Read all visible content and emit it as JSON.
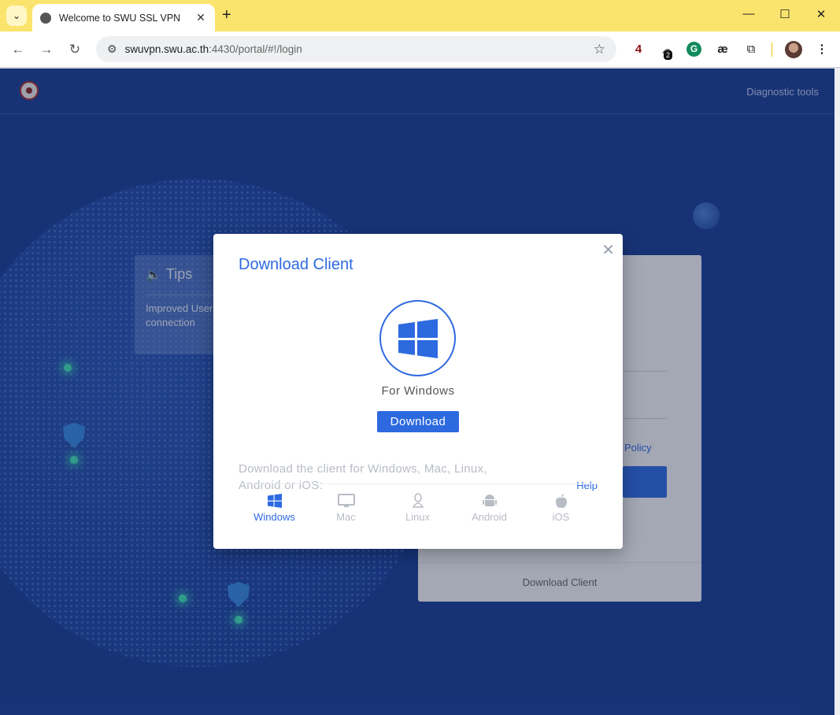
{
  "browser": {
    "tab_title": "Welcome to SWU SSL VPN",
    "url_host": "swuvpn.swu.ac.th",
    "url_rest": ":4430/portal/#!/login",
    "ext_badge": "2",
    "ext_ae": "æ",
    "ext_4": "4"
  },
  "header": {
    "diagnostic_tools": "Diagnostic tools"
  },
  "tips": {
    "title": "Tips",
    "text": "Improved User connection"
  },
  "login": {
    "policy_link": "Policy",
    "download_client": "Download Client"
  },
  "modal": {
    "title": "Download Client",
    "os_label": "For Windows",
    "download_button": "Download",
    "description": "Download the client for Windows, Mac, Linux, Android or iOS:",
    "help_link": "Help",
    "os_tabs": [
      {
        "label": "Windows",
        "icon": "windows-icon",
        "active": true
      },
      {
        "label": "Mac",
        "icon": "mac-icon",
        "active": false
      },
      {
        "label": "Linux",
        "icon": "linux-icon",
        "active": false
      },
      {
        "label": "Android",
        "icon": "android-icon",
        "active": false
      },
      {
        "label": "iOS",
        "icon": "apple-icon",
        "active": false
      }
    ]
  },
  "colors": {
    "accent": "#2d6ae0",
    "page_bg": "#1a3f96",
    "tabbar": "#fbe46e"
  }
}
